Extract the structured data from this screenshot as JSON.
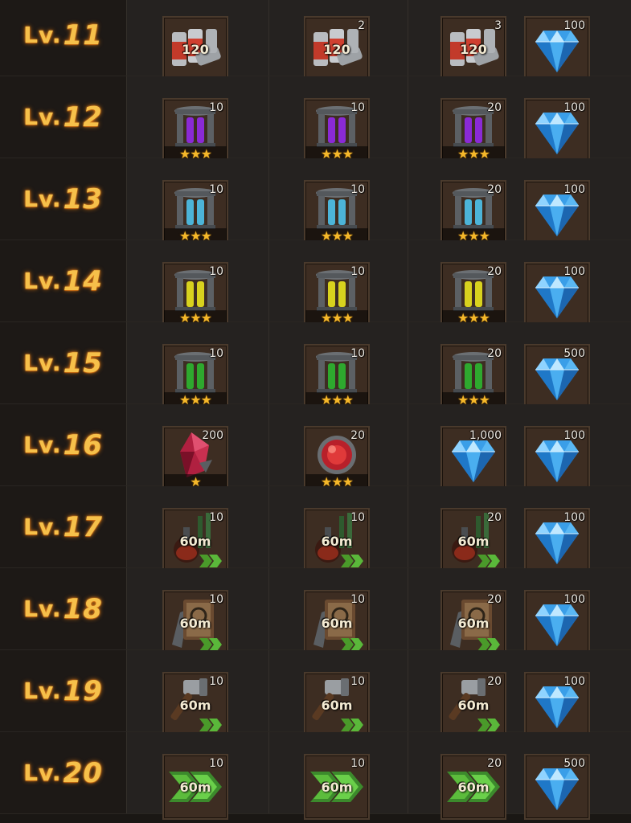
{
  "rows": [
    {
      "level_prefix": "Lv.",
      "level_num": "11",
      "c1_qty": "",
      "c2_qty": "2",
      "c3_qty": "3",
      "c4_qty": "100",
      "item": "cans",
      "label": "120",
      "stars": ""
    },
    {
      "level_prefix": "Lv.",
      "level_num": "12",
      "c1_qty": "10",
      "c2_qty": "10",
      "c3_qty": "20",
      "c4_qty": "100",
      "item": "stand",
      "item_color": "#8a2ad6",
      "label": "",
      "stars": "★★★"
    },
    {
      "level_prefix": "Lv.",
      "level_num": "13",
      "c1_qty": "10",
      "c2_qty": "10",
      "c3_qty": "20",
      "c4_qty": "100",
      "item": "stand",
      "item_color": "#4cb4d8",
      "label": "",
      "stars": "★★★"
    },
    {
      "level_prefix": "Lv.",
      "level_num": "14",
      "c1_qty": "10",
      "c2_qty": "10",
      "c3_qty": "20",
      "c4_qty": "100",
      "item": "stand",
      "item_color": "#d8d21e",
      "label": "",
      "stars": "★★★"
    },
    {
      "level_prefix": "Lv.",
      "level_num": "15",
      "c1_qty": "10",
      "c2_qty": "10",
      "c3_qty": "20",
      "c4_qty": "500",
      "item": "stand",
      "item_color": "#2ea82e",
      "label": "",
      "stars": "★★★"
    },
    {
      "level_prefix": "Lv.",
      "level_num": "16",
      "c1_qty": "200",
      "c2_qty": "20",
      "c3_qty": "1,000",
      "c4_qty": "100",
      "item": "special",
      "label": "",
      "stars_c1": "★",
      "stars_c2": "★★★"
    },
    {
      "level_prefix": "Lv.",
      "level_num": "17",
      "c1_qty": "10",
      "c2_qty": "10",
      "c3_qty": "20",
      "c4_qty": "100",
      "item": "potion",
      "label": "60m",
      "stars": ""
    },
    {
      "level_prefix": "Lv.",
      "level_num": "18",
      "c1_qty": "10",
      "c2_qty": "10",
      "c3_qty": "20",
      "c4_qty": "100",
      "item": "book",
      "label": "60m",
      "stars": ""
    },
    {
      "level_prefix": "Lv.",
      "level_num": "19",
      "c1_qty": "10",
      "c2_qty": "10",
      "c3_qty": "20",
      "c4_qty": "100",
      "item": "hammer",
      "label": "60m",
      "stars": ""
    },
    {
      "level_prefix": "Lv.",
      "level_num": "20",
      "c1_qty": "10",
      "c2_qty": "10",
      "c3_qty": "20",
      "c4_qty": "500",
      "item": "speedup",
      "label": "60m",
      "stars": ""
    }
  ],
  "icons": {
    "gem": "diamond-icon",
    "cans": "cans-icon",
    "stand": "gear-stand-icon",
    "potion": "potion-icon",
    "book": "book-icon",
    "hammer": "hammer-icon",
    "speedup": "speedup-arrows-icon",
    "ruby": "red-crystal-icon",
    "orb": "red-orb-icon"
  },
  "colors": {
    "level_text": "#f6c04a",
    "slot_bg": "#3d2d22",
    "gem": "#3a9ee8",
    "star": "#f5b82a"
  }
}
